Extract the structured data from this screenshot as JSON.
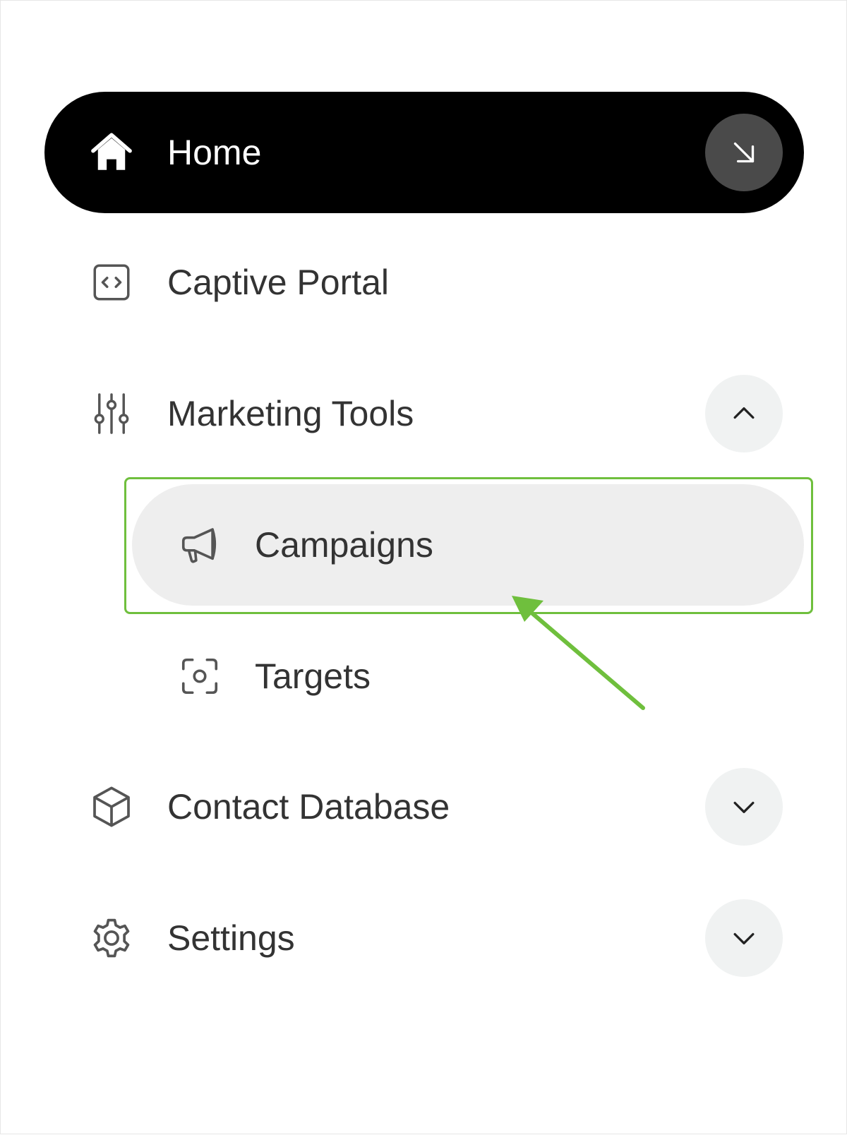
{
  "nav": {
    "home": {
      "label": "Home",
      "icon": "home-icon",
      "action_icon": "arrow-down-right-icon"
    },
    "captive_portal": {
      "label": "Captive Portal",
      "icon": "code-icon"
    },
    "marketing_tools": {
      "label": "Marketing Tools",
      "icon": "sliders-icon",
      "expanded": true,
      "children": [
        {
          "label": "Campaigns",
          "icon": "megaphone-icon",
          "selected": true
        },
        {
          "label": "Targets",
          "icon": "focus-icon"
        }
      ]
    },
    "contact_database": {
      "label": "Contact Database",
      "icon": "cube-icon",
      "expanded": false
    },
    "settings": {
      "label": "Settings",
      "icon": "gear-icon",
      "expanded": false
    }
  },
  "annotation": {
    "highlight_color": "#6fbf3d",
    "target": "Campaigns"
  },
  "colors": {
    "active_bg": "#000000",
    "selected_bg": "#eeeeee",
    "text": "#333333",
    "chevron_bg": "#f0f2f2"
  }
}
